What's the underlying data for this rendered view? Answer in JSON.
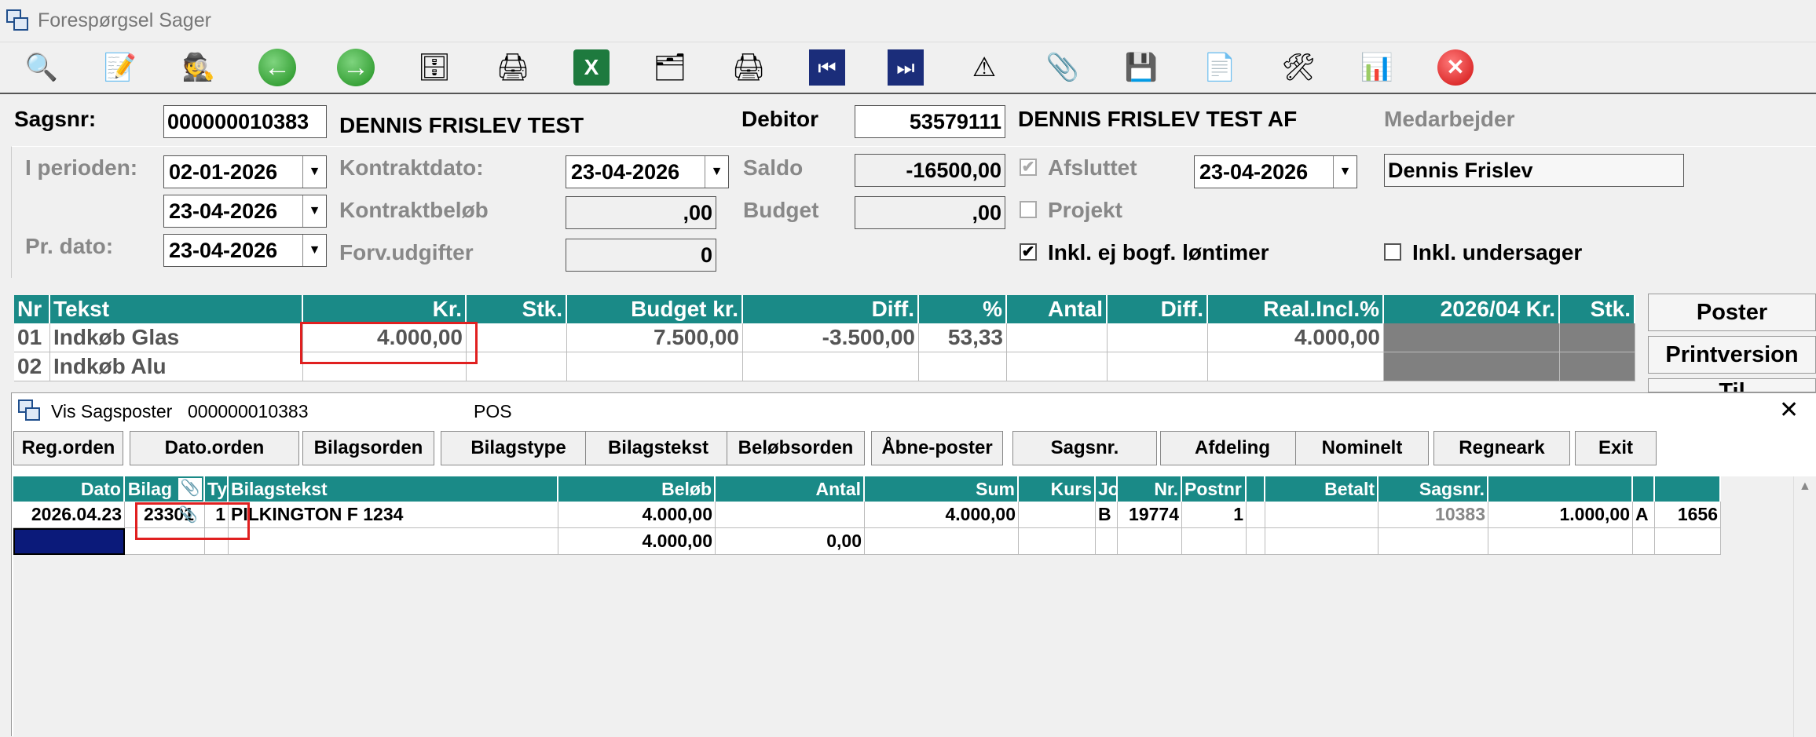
{
  "window": {
    "title": "Forespørgsel Sager"
  },
  "toolbar": {
    "items": [
      "search-icon",
      "edit-icon",
      "find-person-icon",
      "back-icon",
      "forward-icon",
      "archive-icon",
      "print-icon",
      "excel-icon",
      "form-icon",
      "print2-icon",
      "first-record-icon",
      "last-record-icon",
      "warning-icon",
      "attachment-icon",
      "save-icon",
      "text-a-icon",
      "tools-icon",
      "chart-icon",
      "close-red-icon"
    ]
  },
  "header": {
    "sagsnr_label": "Sagsnr:",
    "sagsnr_value": "000000010383",
    "name": "DENNIS FRISLEV TEST",
    "debitor_label": "Debitor",
    "debitor_value": "53579111",
    "debitor_name": "DENNIS FRISLEV TEST AF",
    "medarbejder_label": "Medarbejder",
    "periode_label": "I perioden:",
    "periode_from": "02-01-2026",
    "periode_to": "23-04-2026",
    "prdato_label": "Pr. dato:",
    "prdato_value": "23-04-2026",
    "kontraktdato_label": "Kontraktdato:",
    "kontraktdato_value": "23-04-2026",
    "kontraktbelob_label": "Kontraktbeløb",
    "kontraktbelob_value": ",00",
    "forv_label": "Forv.udgifter",
    "forv_value": "0",
    "saldo_label": "Saldo",
    "saldo_value": "-16500,00",
    "budget_label": "Budget",
    "budget_value": ",00",
    "afsluttet_label": "Afsluttet",
    "afsluttet_date": "23-04-2026",
    "projekt_label": "Projekt",
    "inkl_ej_label": "Inkl. ej bogf. løntimer",
    "inkl_under_label": "Inkl. undersager",
    "medarbejder_value": "Dennis Frislev",
    "check_mark": "✔"
  },
  "main_grid": {
    "headers": [
      "Nr",
      "Tekst",
      "Kr.",
      "Stk.",
      "Budget kr.",
      "Diff.",
      "%",
      "Antal",
      "Diff.",
      "Real.Incl.%",
      "2026/04 Kr.",
      "Stk."
    ],
    "rows": [
      [
        "01",
        "Indkøb Glas",
        "4.000,00",
        "",
        "7.500,00",
        "-3.500,00",
        "53,33",
        "",
        "",
        "4.000,00",
        "",
        ""
      ],
      [
        "02",
        "Indkøb Alu",
        "",
        "",
        "",
        "",
        "",
        "",
        "",
        "",
        "",
        ""
      ]
    ]
  },
  "side_buttons": {
    "poster": "Poster",
    "printversion": "Printversion",
    "third": "Til"
  },
  "popup": {
    "title": "Vis Sagsposter",
    "sagsnr": "000000010383",
    "pos": "POS",
    "close": "✕",
    "buttons": [
      "Reg.orden",
      "Dato.orden",
      "Bilagsorden",
      "Bilagstype",
      "Bilagstekst",
      "Beløbsorden",
      "Åbne-poster",
      "Sagsnr.",
      "Afdeling",
      "Nominelt",
      "Regneark",
      "Exit"
    ],
    "headers": [
      "Dato",
      "Bilag",
      "Ty",
      "Bilagstekst",
      "Beløb",
      "Antal",
      "Sum",
      "Kurs",
      "Jo",
      "Nr.",
      "Postnr",
      "",
      "Betalt",
      "Sagsnr.",
      "",
      "",
      ""
    ],
    "row1": [
      "2026.04.23",
      "23301",
      "1",
      "PILKINGTON F 1234",
      "4.000,00",
      "",
      "4.000,00",
      "",
      "B",
      "19774",
      "1",
      "",
      "",
      "10383",
      "1.000,00",
      "A",
      "1656"
    ],
    "total": {
      "belob": "4.000,00",
      "antal": "0,00"
    },
    "scroll_up": "▲"
  }
}
